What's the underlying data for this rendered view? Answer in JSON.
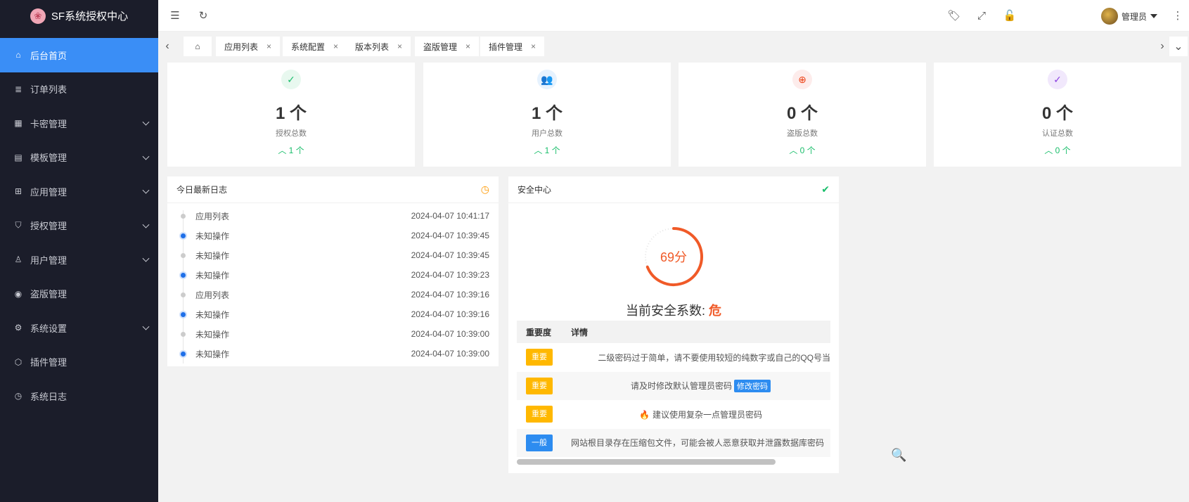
{
  "app": {
    "title": "SF系统授权中心"
  },
  "sidebar": {
    "items": [
      {
        "label": "后台首页",
        "icon": "home-icon",
        "glyph": "⌂"
      },
      {
        "label": "订单列表",
        "icon": "order-list-icon",
        "glyph": "≣"
      },
      {
        "label": "卡密管理",
        "icon": "card-icon",
        "glyph": "▦"
      },
      {
        "label": "模板管理",
        "icon": "template-icon",
        "glyph": "▤"
      },
      {
        "label": "应用管理",
        "icon": "apps-icon",
        "glyph": "⊞"
      },
      {
        "label": "授权管理",
        "icon": "shield-icon",
        "glyph": "⛉"
      },
      {
        "label": "用户管理",
        "icon": "user-icon",
        "glyph": "♙"
      },
      {
        "label": "盗版管理",
        "icon": "globe-icon",
        "glyph": "◉"
      },
      {
        "label": "系统设置",
        "icon": "gear-icon",
        "glyph": "⚙"
      },
      {
        "label": "插件管理",
        "icon": "cube-icon",
        "glyph": "⬡"
      },
      {
        "label": "系统日志",
        "icon": "clock-icon",
        "glyph": "◷"
      }
    ]
  },
  "header": {
    "user_name": "管理员"
  },
  "tabs": [
    {
      "label": "应用列表"
    },
    {
      "label": "系统配置"
    },
    {
      "label": "版本列表"
    },
    {
      "label": "盗版管理"
    },
    {
      "label": "插件管理"
    }
  ],
  "stats": [
    {
      "value": "1 个",
      "label": "授权总数",
      "delta": "1 个",
      "icon": "shield-check-icon",
      "color": "#19be6b",
      "bg": "#e8f8ef",
      "glyph": "✓"
    },
    {
      "value": "1 个",
      "label": "用户总数",
      "delta": "1 个",
      "icon": "users-icon",
      "color": "#2d8cf0",
      "bg": "#e6f2fe",
      "glyph": "👥"
    },
    {
      "value": "0 个",
      "label": "盗版总数",
      "delta": "0 个",
      "icon": "globe-icon",
      "color": "#ed4014",
      "bg": "#fdeceb",
      "glyph": "⊕"
    },
    {
      "value": "0 个",
      "label": "认证总数",
      "delta": "0 个",
      "icon": "check-circle-icon",
      "color": "#8b3fe0",
      "bg": "#f1e8fc",
      "glyph": "✓"
    }
  ],
  "log_panel": {
    "title": "今日最新日志",
    "entries": [
      {
        "name": "应用列表",
        "time": "2024-04-07 10:41:17",
        "highlight": false
      },
      {
        "name": "未知操作",
        "time": "2024-04-07 10:39:45",
        "highlight": true
      },
      {
        "name": "未知操作",
        "time": "2024-04-07 10:39:45",
        "highlight": false
      },
      {
        "name": "未知操作",
        "time": "2024-04-07 10:39:23",
        "highlight": true
      },
      {
        "name": "应用列表",
        "time": "2024-04-07 10:39:16",
        "highlight": false
      },
      {
        "name": "未知操作",
        "time": "2024-04-07 10:39:16",
        "highlight": true
      },
      {
        "name": "未知操作",
        "time": "2024-04-07 10:39:00",
        "highlight": false
      },
      {
        "name": "未知操作",
        "time": "2024-04-07 10:39:00",
        "highlight": true
      }
    ]
  },
  "security": {
    "title": "安全中心",
    "score": 69,
    "score_text": "69分",
    "level_label": "当前安全系数:",
    "level_value": "危",
    "columns": [
      "重要度",
      "详情"
    ],
    "rows": [
      {
        "level": "重要",
        "type": "imp",
        "detail": "二级密码过于简单，请不要使用较短的纯数字或自己的QQ号当",
        "action": ""
      },
      {
        "level": "重要",
        "type": "imp",
        "detail": "请及时修改默认管理员密码",
        "action": "修改密码"
      },
      {
        "level": "重要",
        "type": "imp",
        "detail": "建议使用复杂一点管理员密码",
        "action": ""
      },
      {
        "level": "一般",
        "type": "gen",
        "detail": "网站根目录存在压缩包文件，可能会被人恶意获取并泄露数据库密码",
        "action": ""
      }
    ],
    "colors": {
      "score": "#f05a28",
      "track": "#e5e5e5"
    }
  }
}
